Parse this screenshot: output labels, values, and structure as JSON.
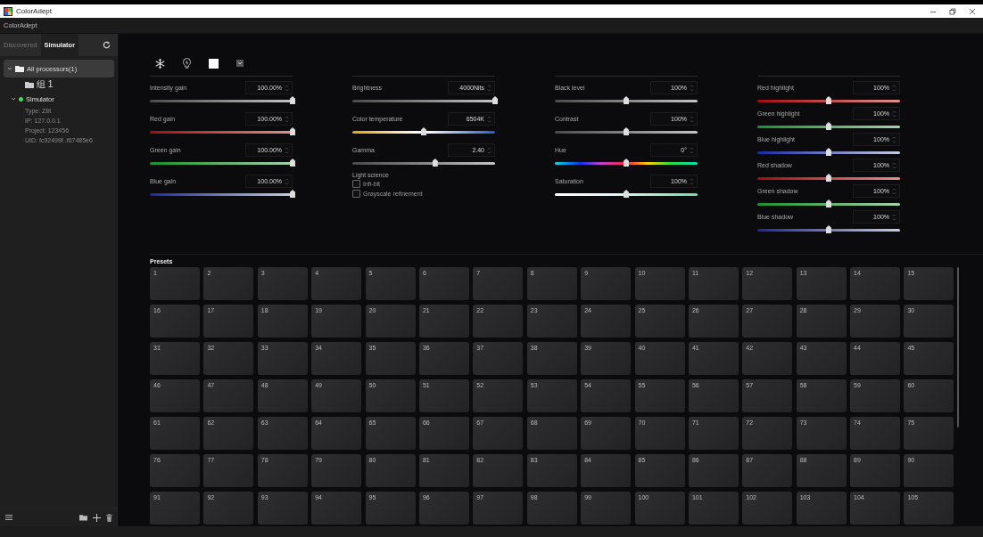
{
  "window": {
    "title": "ColorAdept"
  },
  "menu_bar": {
    "title": "ColorAdept"
  },
  "sidebar": {
    "tabs": [
      {
        "label": "Discovered",
        "selected": false
      },
      {
        "label": "Simulator",
        "selected": true
      }
    ],
    "tree": [
      {
        "label": "All processors(1)",
        "selected": true,
        "expanded": true,
        "children": [
          {
            "kind": "group",
            "label": "组 1",
            "selected": false
          },
          {
            "kind": "device",
            "label": "Simulator",
            "selected": false,
            "expanded": true,
            "online": true,
            "details": [
              "Type: Z8t",
              "IP: 127.0.0.1",
              "Project: 123456",
              "UID: fc92499f..f67485e6"
            ]
          }
        ]
      }
    ]
  },
  "columns": [
    {
      "sliders": [
        {
          "label": "Intensity gain",
          "reading": "100.00%",
          "kind": "gray",
          "level": 1
        },
        {
          "label": "Red gain",
          "reading": "100.00%",
          "kind": "red",
          "level": 1
        },
        {
          "label": "Green gain",
          "reading": "100.00%",
          "kind": "green",
          "level": 1
        },
        {
          "label": "Blue gain",
          "reading": "100.00%",
          "kind": "blue",
          "level": 1
        }
      ]
    },
    {
      "sliders": [
        {
          "label": "Brightness",
          "reading": "4000Nits",
          "kind": "gray",
          "level": 1
        },
        {
          "label": "Color temperature",
          "reading": "6504K",
          "kind": "temperature",
          "level": 0.5
        },
        {
          "label": "Gamma",
          "reading": "2.40",
          "kind": "gray",
          "level": 0.58
        }
      ],
      "light_science": {
        "title": "Light science",
        "options": [
          {
            "label": "Infi-bit",
            "checked": false
          },
          {
            "label": "Grayscale refinement",
            "checked": false
          }
        ]
      }
    },
    {
      "sliders": [
        {
          "label": "Black level",
          "reading": "100%",
          "kind": "gray",
          "level": 0.5
        },
        {
          "label": "Contrast",
          "reading": "100%",
          "kind": "gray",
          "level": 0.5
        },
        {
          "label": "Hue",
          "reading": "0°",
          "kind": "hue",
          "level": 0.5
        },
        {
          "label": "Saturation",
          "reading": "100%",
          "kind": "saturation",
          "level": 0.5
        }
      ]
    },
    {
      "sliders": [
        {
          "label": "Red highlight",
          "reading": "100%",
          "kind": "red",
          "level": 0.5
        },
        {
          "label": "Green highlight",
          "reading": "100%",
          "kind": "green",
          "level": 0.5
        },
        {
          "label": "Blue highlight",
          "reading": "100%",
          "kind": "blue",
          "level": 0.5
        },
        {
          "label": "Red shadow",
          "reading": "100%",
          "kind": "red",
          "level": 0.5
        },
        {
          "label": "Green shadow",
          "reading": "100%",
          "kind": "green",
          "level": 0.5
        },
        {
          "label": "Blue shadow",
          "reading": "100%",
          "kind": "blue",
          "level": 0.5
        }
      ]
    }
  ],
  "presets": {
    "title": "Presets",
    "items": [
      "1",
      "2",
      "3",
      "4",
      "5",
      "6",
      "7",
      "8",
      "9",
      "10",
      "11",
      "12",
      "13",
      "14",
      "15",
      "16",
      "17",
      "18",
      "19",
      "20",
      "21",
      "22",
      "23",
      "24",
      "25",
      "26",
      "27",
      "28",
      "29",
      "30",
      "31",
      "32",
      "33",
      "34",
      "35",
      "36",
      "37",
      "38",
      "39",
      "40",
      "41",
      "42",
      "43",
      "44",
      "45",
      "46",
      "47",
      "48",
      "49",
      "50",
      "51",
      "52",
      "53",
      "54",
      "55",
      "56",
      "57",
      "58",
      "59",
      "60",
      "61",
      "62",
      "63",
      "64",
      "65",
      "66",
      "67",
      "68",
      "69",
      "70",
      "71",
      "72",
      "73",
      "74",
      "75",
      "76",
      "77",
      "78",
      "79",
      "80",
      "81",
      "82",
      "83",
      "84",
      "85",
      "86",
      "87",
      "88",
      "89",
      "90",
      "91",
      "92",
      "93",
      "94",
      "95",
      "96",
      "97",
      "98",
      "99",
      "100",
      "101",
      "102",
      "103",
      "104",
      "105"
    ]
  }
}
